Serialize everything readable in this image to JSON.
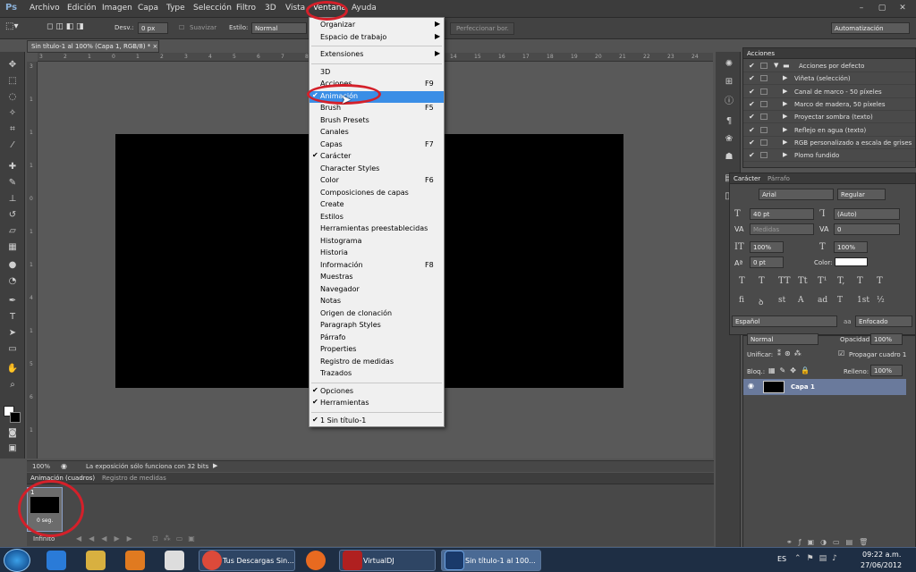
{
  "app": {
    "logo": "Ps"
  },
  "menubar": {
    "items": [
      "Archivo",
      "Edición",
      "Imagen",
      "Capa",
      "Type",
      "Selección",
      "Filtro",
      "3D",
      "Vista",
      "Ventana",
      "Ayuda"
    ],
    "window_buttons": [
      "–",
      "▢",
      "✕"
    ]
  },
  "options": {
    "desv_label": "Desv.:",
    "desv_value": "0 px",
    "suavizar": "Suavizar",
    "estilo_label": "Estilo:",
    "estilo_value": "Normal",
    "perfeccionar": "Perfeccionar bor.",
    "workspace": "Automatización"
  },
  "document": {
    "tab_title": "Sin título-1 al 100% (Capa 1, RGB/8) * ×",
    "ruler_top": [
      "3",
      "2",
      "1",
      "0",
      "1",
      "2",
      "3",
      "4",
      "5",
      "6",
      "7",
      "8",
      "9",
      "10",
      "11",
      "12",
      "13",
      "14",
      "15",
      "16",
      "17",
      "18",
      "19",
      "20",
      "21",
      "22",
      "23",
      "24",
      "25"
    ],
    "ruler_left": [
      "3",
      "1",
      "1",
      "1",
      "0",
      "1",
      "1",
      "4",
      "1",
      "5",
      "6",
      "1"
    ]
  },
  "status": {
    "zoom": "100%",
    "message": "La exposición sólo funciona con 32 bits"
  },
  "animation": {
    "tab_active": "Animación (cuadros)",
    "tab_other": "Registro de medidas",
    "frame_number": "1",
    "frame_delay": "0 seg.",
    "loop": "Infinito"
  },
  "dropdown": {
    "groups": [
      [
        {
          "label": "Organizar",
          "submenu": true
        },
        {
          "label": "Espacio de trabajo",
          "submenu": true
        }
      ],
      [
        {
          "label": "Extensiones",
          "submenu": true
        }
      ],
      [
        {
          "label": "3D"
        },
        {
          "label": "Acciones",
          "key": "F9"
        },
        {
          "label": "Animación",
          "checked": true,
          "highlight": true
        },
        {
          "label": "Brush",
          "key": "F5"
        },
        {
          "label": "Brush Presets"
        },
        {
          "label": "Canales"
        },
        {
          "label": "Capas",
          "key": "F7"
        },
        {
          "label": "Carácter",
          "checked": true
        },
        {
          "label": "Character Styles"
        },
        {
          "label": "Color",
          "key": "F6"
        },
        {
          "label": "Composiciones de capas"
        },
        {
          "label": "Create"
        },
        {
          "label": "Estilos"
        },
        {
          "label": "Herramientas preestablecidas"
        },
        {
          "label": "Histograma"
        },
        {
          "label": "Historia"
        },
        {
          "label": "Información",
          "key": "F8"
        },
        {
          "label": "Muestras"
        },
        {
          "label": "Navegador"
        },
        {
          "label": "Notas"
        },
        {
          "label": "Origen de clonación"
        },
        {
          "label": "Paragraph Styles"
        },
        {
          "label": "Párrafo"
        },
        {
          "label": "Properties"
        },
        {
          "label": "Registro de medidas"
        },
        {
          "label": "Trazados"
        }
      ],
      [
        {
          "label": "Opciones",
          "checked": true
        },
        {
          "label": "Herramientas",
          "checked": true
        }
      ],
      [
        {
          "label": "1 Sin título-1",
          "checked": true
        }
      ]
    ]
  },
  "acciones": {
    "title": "Acciones",
    "rows": [
      {
        "label": "Acciones por defecto",
        "folder": true
      },
      {
        "label": "Viñeta (selección)"
      },
      {
        "label": "Canal de marco - 50 píxeles"
      },
      {
        "label": "Marco de madera, 50 píxeles"
      },
      {
        "label": "Proyectar sombra (texto)"
      },
      {
        "label": "Reflejo en agua (texto)"
      },
      {
        "label": "RGB personalizado a escala de grises"
      },
      {
        "label": "Plomo fundido"
      }
    ]
  },
  "caracter": {
    "tab_active": "Carácter",
    "tab_other": "Párrafo",
    "font": "Arial",
    "style": "Regular",
    "size": "40 pt",
    "leading": "(Auto)",
    "kerning": "Medidas",
    "tracking": "0",
    "vscale": "100%",
    "hscale": "100%",
    "baseline": "0 pt",
    "color_label": "Color:",
    "language": "Español",
    "aa_label": "aa",
    "antialias": "Enfocado",
    "type_buttons": [
      "T",
      "T",
      "TT",
      "Tt",
      "T¹",
      "T,",
      "T",
      "T"
    ],
    "glyph_buttons": [
      "fi",
      "ꝺ",
      "st",
      "A",
      "ad",
      "T",
      "1st",
      "½"
    ]
  },
  "capas": {
    "blend": "Normal",
    "opacity_label": "Opacidad:",
    "opacity": "100%",
    "unify_label": "Unificar:",
    "propagate": "Propagar cuadro 1",
    "lock_label": "Bloq.:",
    "fill_label": "Relleno:",
    "fill": "100%",
    "layer_name": "Capa 1"
  },
  "taskbar": {
    "buttons": [
      "Tus Descargas Sin...",
      "VirtualDJ",
      "Sin título-1 al 100..."
    ],
    "lang": "ES",
    "time": "09:22 a.m.",
    "date": "27/06/2012"
  }
}
